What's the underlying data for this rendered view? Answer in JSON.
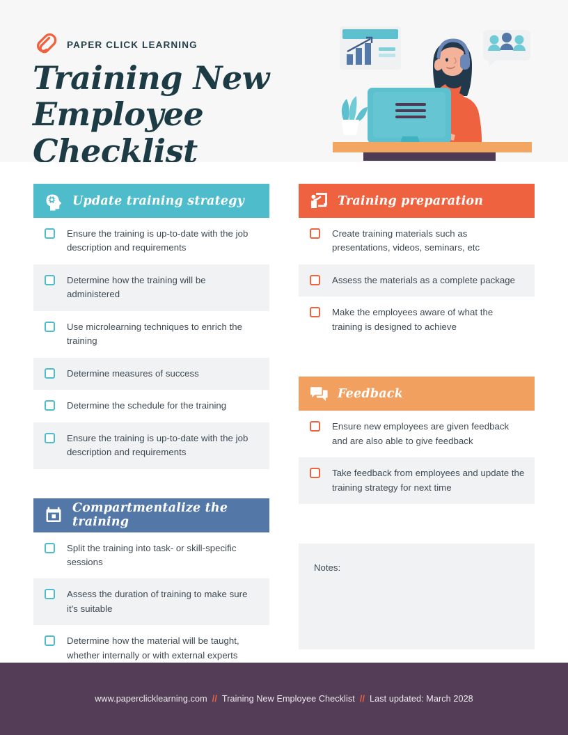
{
  "header": {
    "logo_icon": "paperclip-icon",
    "brand": "PAPER CLICK LEARNING",
    "title_line1": "Training New",
    "title_line2": "Employee Checklist",
    "illustration": "woman-with-headphones-at-desk-illustration"
  },
  "colors": {
    "teal": "#4ebccb",
    "orange_red": "#ef6240",
    "slate_blue": "#5378a8",
    "light_orange": "#f2a060",
    "dark_purple": "#543e57",
    "header_bg": "#f7f7f7",
    "row_alt": "#f1f2f3",
    "text": "#3d4952",
    "heading": "#1d3b44"
  },
  "sections": [
    {
      "id": "update-training-strategy",
      "title": "Update training strategy",
      "icon": "head-with-gear-icon",
      "color": "#4ebccb",
      "checkbox_color": "#4ebccb",
      "column": "left",
      "items": [
        "Ensure the training is up-to-date with the job description and requirements",
        "Determine how the training will be administered",
        "Use microlearning techniques to enrich the training",
        "Determine measures of success",
        "Determine the schedule for the training",
        "Ensure the training is up-to-date with the job description and requirements"
      ]
    },
    {
      "id": "compartmentalize-the-training",
      "title": "Compartmentalize the training",
      "icon": "calendar-icon",
      "color": "#5378a8",
      "checkbox_color": "#4ebccb",
      "column": "left",
      "items": [
        "Split the training into task- or skill-specific sessions",
        "Assess the duration of training to make sure it's suitable",
        "Determine how the material will be taught, whether internally or with external experts"
      ]
    },
    {
      "id": "training-preparation",
      "title": "Training preparation",
      "icon": "presenter-board-icon",
      "color": "#ef6240",
      "checkbox_color": "#ef6240",
      "column": "right",
      "items": [
        "Create training materials such as presentations, videos, seminars, etc",
        "Assess the materials as a complete package",
        "Make the employees aware of what the training is designed to achieve"
      ]
    },
    {
      "id": "feedback",
      "title": "Feedback",
      "icon": "chat-bubbles-icon",
      "color": "#f2a060",
      "checkbox_color": "#ef6240",
      "column": "right",
      "items": [
        "Ensure new employees are given feedback and are also able to give feedback",
        "Take feedback from employees and update the training strategy for next time"
      ]
    }
  ],
  "notes": {
    "label": "Notes:",
    "value": ""
  },
  "footer": {
    "website": "www.paperclicklearning.com",
    "sep1": "//",
    "doc_title": "Training New Employee Checklist",
    "sep2": "//",
    "updated": "Last updated: March 2028"
  }
}
